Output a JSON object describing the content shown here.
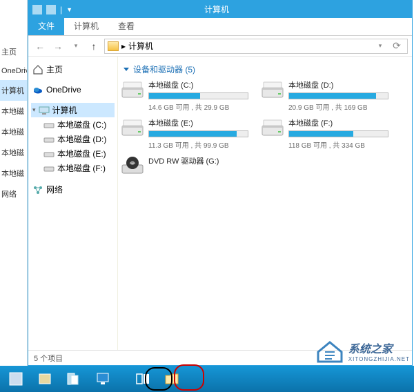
{
  "window_title": "计算机",
  "ribbon": {
    "file": "文件",
    "computer": "计算机",
    "view": "查看"
  },
  "breadcrumb": {
    "chev": "▸",
    "label": "计算机"
  },
  "left_panel": {
    "home": "主页",
    "onedrive": "OneDrive",
    "computer": "计算机",
    "c": "本地磁",
    "d": "本地磁",
    "e": "本地磁",
    "f": "本地磁",
    "net": "网络"
  },
  "tree": {
    "home": "主页",
    "onedrive": "OneDrive",
    "computer": "计算机",
    "drive_c": "本地磁盘 (C:)",
    "drive_d": "本地磁盘 (D:)",
    "drive_e": "本地磁盘 (E:)",
    "drive_f": "本地磁盘 (F:)",
    "network": "网络"
  },
  "group": {
    "title": "设备和驱动器 (5)"
  },
  "drives": [
    {
      "name": "本地磁盘 (C:)",
      "stat": "14.6 GB 可用 , 共 29.9 GB",
      "fill": 52
    },
    {
      "name": "本地磁盘 (D:)",
      "stat": "20.9 GB 可用 , 共 169 GB",
      "fill": 88
    },
    {
      "name": "本地磁盘 (E:)",
      "stat": "11.3 GB 可用 , 共 99.9 GB",
      "fill": 89
    },
    {
      "name": "本地磁盘 (F:)",
      "stat": "118 GB 可用 , 共 334 GB",
      "fill": 65
    },
    {
      "name": "DVD RW 驱动器 (G:)",
      "stat": "",
      "fill": 0,
      "dvd": true
    }
  ],
  "status": "5 个项目",
  "watermark": {
    "text": "系统之家",
    "sub": "XITONGZHIJIA.NET"
  }
}
